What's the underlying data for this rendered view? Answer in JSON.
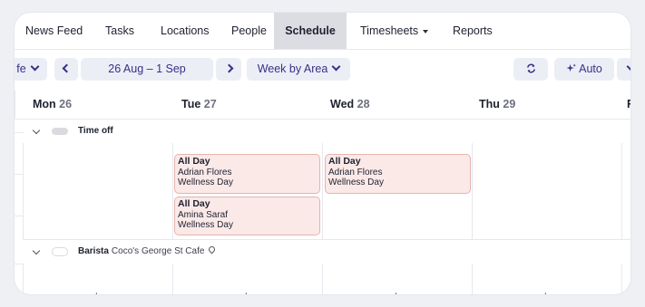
{
  "nav": {
    "items": [
      {
        "label": "News Feed"
      },
      {
        "label": "Tasks"
      },
      {
        "label": "Locations"
      },
      {
        "label": "People"
      },
      {
        "label": "Schedule",
        "active": true
      },
      {
        "label": "Timesheets"
      },
      {
        "label": "Reports"
      }
    ]
  },
  "toolbar": {
    "area_label": "fe",
    "date_range": "26 Aug – 1 Sep",
    "view_label": "Week by Area",
    "refresh_icon": "refresh-icon",
    "auto_label": "Auto",
    "auto_icon": "sparkle-icon"
  },
  "days": [
    {
      "name": "Mon",
      "num": "26"
    },
    {
      "name": "Tue",
      "num": "27"
    },
    {
      "name": "Wed",
      "num": "28"
    },
    {
      "name": "Thu",
      "num": "29"
    },
    {
      "name": "F",
      "num": ""
    }
  ],
  "sections": {
    "timeoff": {
      "title": "Time off"
    },
    "barista": {
      "title": "Barista",
      "subtitle": "Coco's George St Cafe"
    }
  },
  "shifts": [
    {
      "title": "All Day",
      "person": "Adrian Flores",
      "type": "Wellness Day"
    },
    {
      "title": "All Day",
      "person": "Amina Saraf",
      "type": "Wellness Day"
    },
    {
      "title": "All Day",
      "person": "Adrian Flores",
      "type": "Wellness Day"
    }
  ],
  "add_symbol": "+",
  "colors": {
    "accent": "#3a2f86",
    "button_bg": "#eceef6",
    "active_tab_bg": "#dcdde2",
    "timeoff_card_bg": "#fbe9e8",
    "timeoff_card_border": "#e4b4ae"
  }
}
